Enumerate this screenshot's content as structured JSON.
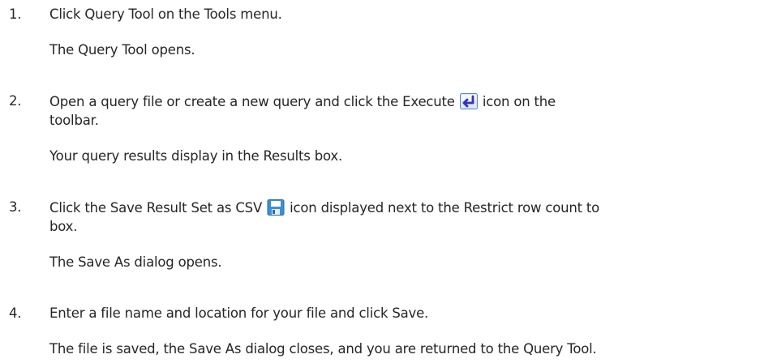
{
  "steps": [
    {
      "number": "1.",
      "action": "Click Query Tool on the Tools menu.",
      "result": "The Query Tool opens."
    },
    {
      "number": "2.",
      "action_before_icon": "Open a query file or create a new query and click the Execute",
      "icon": "execute-icon",
      "action_after_icon": "icon on the",
      "action_line2": "toolbar.",
      "result": "Your query results display in the Results box."
    },
    {
      "number": "3.",
      "action_before_icon": "Click the Save Result Set as CSV",
      "icon": "save-icon",
      "action_after_icon": "icon displayed next to the Restrict row count to",
      "action_line2": "box.",
      "result": "The Save As dialog opens."
    },
    {
      "number": "4.",
      "action": "Enter a file name and location for your file and click Save.",
      "result": "The file is saved, the Save As dialog closes, and you are returned to the Query Tool."
    }
  ]
}
